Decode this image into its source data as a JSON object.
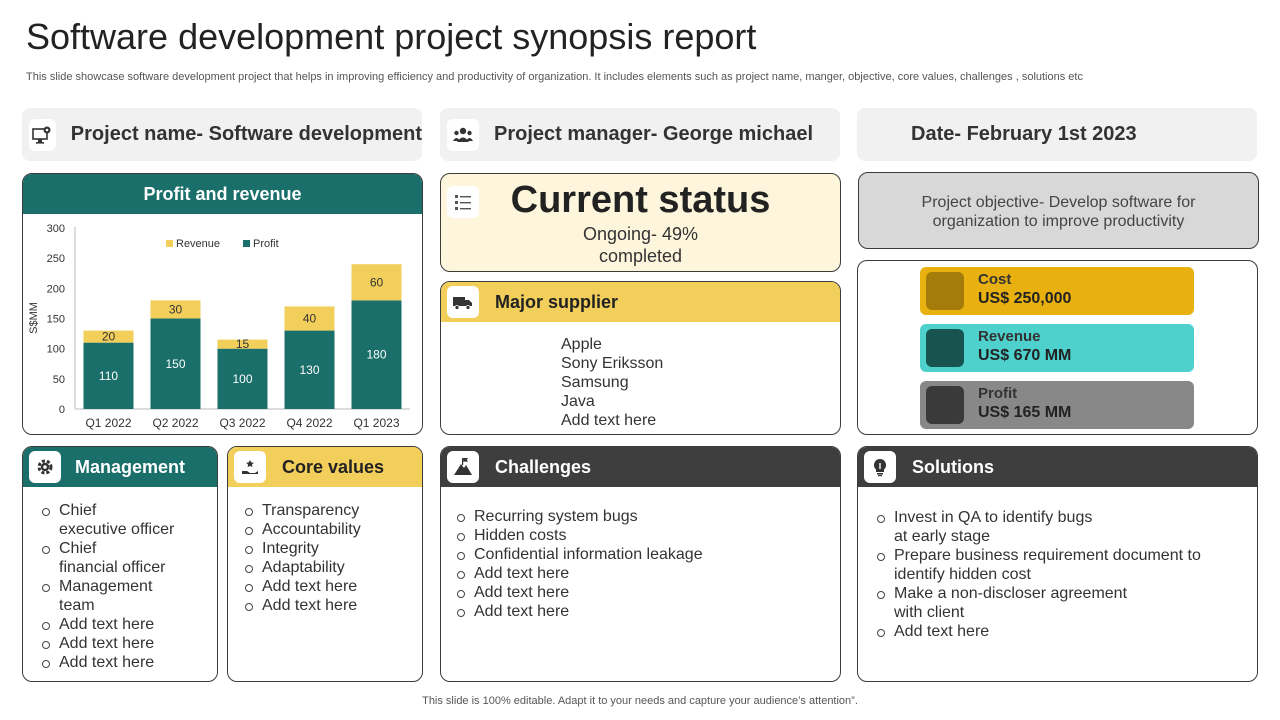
{
  "header": {
    "title": "Software development project synopsis report",
    "subtitle": "This slide showcase software development project that helps in improving efficiency and productivity of organization. It includes elements such as project name, manger, objective, core values, challenges , solutions etc"
  },
  "info": {
    "project_name": "Project name- Software development",
    "project_manager": "Project manager- George michael",
    "date": "Date- February 1st 2023"
  },
  "profit_revenue": {
    "title": "Profit and revenue"
  },
  "chart_data": {
    "type": "bar",
    "stacked": true,
    "categories": [
      "Q1 2022",
      "Q2 2022",
      "Q3 2022",
      "Q4 2022",
      "Q1 2023"
    ],
    "series": [
      {
        "name": "Profit",
        "values": [
          110,
          150,
          100,
          130,
          180
        ],
        "color": "#1a6f6a"
      },
      {
        "name": "Revenue",
        "values": [
          20,
          30,
          15,
          40,
          60
        ],
        "color": "#f2cf5b"
      }
    ],
    "ylabel": "S$MM",
    "ylim": [
      0,
      300
    ],
    "yticks": [
      0,
      50,
      100,
      150,
      200,
      250,
      300
    ],
    "legend": "top-center",
    "grid": false
  },
  "status": {
    "title": "Current status",
    "line1": "Ongoing- 49%",
    "line2": "completed"
  },
  "supplier": {
    "title": "Major supplier",
    "items": [
      "Apple",
      "Sony Eriksson",
      "Samsung",
      "Java",
      "Add text here"
    ]
  },
  "objective": {
    "line1": "Project objective- Develop software for",
    "line2": "organization to improve productivity"
  },
  "financials": {
    "cost_label": "Cost",
    "cost_value": "US$ 250,000",
    "revenue_label": "Revenue",
    "revenue_value": "US$ 670 MM",
    "profit_label": "Profit",
    "profit_value": "US$ 165 MM"
  },
  "management": {
    "title": "Management",
    "items": [
      [
        "Chief",
        "executive officer"
      ],
      [
        "Chief",
        "financial officer"
      ],
      [
        "Management",
        "team"
      ],
      [
        "Add text here"
      ],
      [
        "Add text here"
      ],
      [
        "Add text here"
      ]
    ]
  },
  "core_values": {
    "title": "Core values",
    "items": [
      "Transparency",
      "Accountability",
      "Integrity",
      "Adaptability",
      "Add text here",
      "Add text here"
    ]
  },
  "challenges": {
    "title": "Challenges",
    "items": [
      "Recurring system bugs",
      "Hidden costs",
      "Confidential information leakage",
      "Add text here",
      "Add text here",
      "Add text here"
    ]
  },
  "solutions": {
    "title": "Solutions",
    "items": [
      [
        "Invest  in QA to identify bugs",
        "at early stage"
      ],
      [
        "Prepare business requirement document to",
        "identify hidden cost"
      ],
      [
        "Make a non-discloser agreement",
        "with client"
      ],
      [
        "Add text here"
      ]
    ]
  },
  "footer": {
    "text": "This slide is 100% editable. Adapt it to your needs and capture your audience’s attention”."
  },
  "colors": {
    "teal": "#1a6f6a",
    "gold": "#f2cf5b",
    "dark": "#3e3e3e",
    "cream": "#fdf6dc",
    "cost": "#e9b10f",
    "revenue": "#4ed1cc",
    "profit": "#888888"
  }
}
